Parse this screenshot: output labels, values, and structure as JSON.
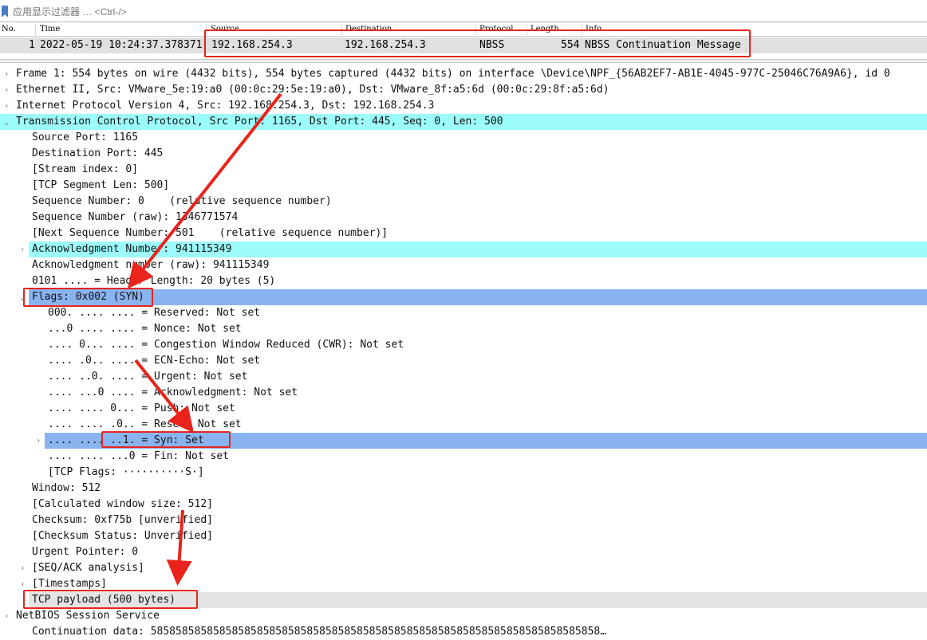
{
  "filter": {
    "placeholder": "应用显示过滤器 … <Ctrl-/>"
  },
  "packet_list": {
    "columns": [
      "No.",
      "Time",
      "Source",
      "Destination",
      "Protocol",
      "Length",
      "Info"
    ],
    "row": {
      "no": "1",
      "time": "2022-05-19 10:24:37.378371",
      "source": "192.168.254.3",
      "destination": "192.168.254.3",
      "protocol": "NBSS",
      "length": "554",
      "info": "NBSS Continuation Message"
    }
  },
  "details": [
    {
      "indent": 0,
      "expander": "›",
      "text": "Frame 1: 554 bytes on wire (4432 bits), 554 bytes captured (4432 bits) on interface \\Device\\NPF_{56AB2EF7-AB1E-4045-977C-25046C76A9A6}, id 0"
    },
    {
      "indent": 0,
      "expander": "›",
      "text": "Ethernet II, Src: VMware_5e:19:a0 (00:0c:29:5e:19:a0), Dst: VMware_8f:a5:6d (00:0c:29:8f:a5:6d)"
    },
    {
      "indent": 0,
      "expander": "›",
      "text": "Internet Protocol Version 4, Src: 192.168.254.3, Dst: 192.168.254.3"
    },
    {
      "indent": 0,
      "expander": "⌄",
      "text": "Transmission Control Protocol, Src Port: 1165, Dst Port: 445, Seq: 0, Len: 500",
      "highlight": "cyan"
    },
    {
      "indent": 1,
      "expander": "",
      "text": "Source Port: 1165"
    },
    {
      "indent": 1,
      "expander": "",
      "text": "Destination Port: 445"
    },
    {
      "indent": 1,
      "expander": "",
      "text": "[Stream index: 0]"
    },
    {
      "indent": 1,
      "expander": "",
      "text": "[TCP Segment Len: 500]"
    },
    {
      "indent": 1,
      "expander": "",
      "text": "Sequence Number: 0    (relative sequence number)"
    },
    {
      "indent": 1,
      "expander": "",
      "text": "Sequence Number (raw): 1346771574"
    },
    {
      "indent": 1,
      "expander": "",
      "text": "[Next Sequence Number: 501    (relative sequence number)]"
    },
    {
      "indent": 1,
      "expander": "›",
      "text": "Acknowledgment Number: 941115349",
      "highlight": "cyan"
    },
    {
      "indent": 1,
      "expander": "",
      "text": "Acknowledgment number (raw): 941115349"
    },
    {
      "indent": 1,
      "expander": "",
      "text": "0101 .... = Header Length: 20 bytes (5)"
    },
    {
      "indent": 1,
      "expander": "⌄",
      "text": "Flags: 0x002 (SYN)",
      "highlight": "blue"
    },
    {
      "indent": 2,
      "expander": "",
      "text": "000. .... .... = Reserved: Not set"
    },
    {
      "indent": 2,
      "expander": "",
      "text": "...0 .... .... = Nonce: Not set"
    },
    {
      "indent": 2,
      "expander": "",
      "text": ".... 0... .... = Congestion Window Reduced (CWR): Not set"
    },
    {
      "indent": 2,
      "expander": "",
      "text": ".... .0.. .... = ECN-Echo: Not set"
    },
    {
      "indent": 2,
      "expander": "",
      "text": ".... ..0. .... = Urgent: Not set"
    },
    {
      "indent": 2,
      "expander": "",
      "text": ".... ...0 .... = Acknowledgment: Not set"
    },
    {
      "indent": 2,
      "expander": "",
      "text": ".... .... 0... = Push: Not set"
    },
    {
      "indent": 2,
      "expander": "",
      "text": ".... .... .0.. = Reset: Not set"
    },
    {
      "indent": 2,
      "expander": "›",
      "text": ".... .... ..1. = Syn: Set",
      "highlight": "blue"
    },
    {
      "indent": 2,
      "expander": "",
      "text": ".... .... ...0 = Fin: Not set"
    },
    {
      "indent": 2,
      "expander": "",
      "text": "[TCP Flags: ··········S·]"
    },
    {
      "indent": 1,
      "expander": "",
      "text": "Window: 512"
    },
    {
      "indent": 1,
      "expander": "",
      "text": "[Calculated window size: 512]"
    },
    {
      "indent": 1,
      "expander": "",
      "text": "Checksum: 0xf75b [unverified]"
    },
    {
      "indent": 1,
      "expander": "",
      "text": "[Checksum Status: Unverified]"
    },
    {
      "indent": 1,
      "expander": "",
      "text": "Urgent Pointer: 0"
    },
    {
      "indent": 1,
      "expander": "›",
      "text": "[SEQ/ACK analysis]"
    },
    {
      "indent": 1,
      "expander": "›",
      "text": "[Timestamps]"
    },
    {
      "indent": 1,
      "expander": "",
      "text": "TCP payload (500 bytes)",
      "highlight": "gray"
    },
    {
      "indent": 0,
      "expander": "›",
      "text": "NetBIOS Session Service"
    },
    {
      "indent": 1,
      "expander": "",
      "text": "Continuation data: 585858585858585858585858585858585858585858585858585858585858585858585858…"
    }
  ],
  "annotation_color": "#e8241c"
}
